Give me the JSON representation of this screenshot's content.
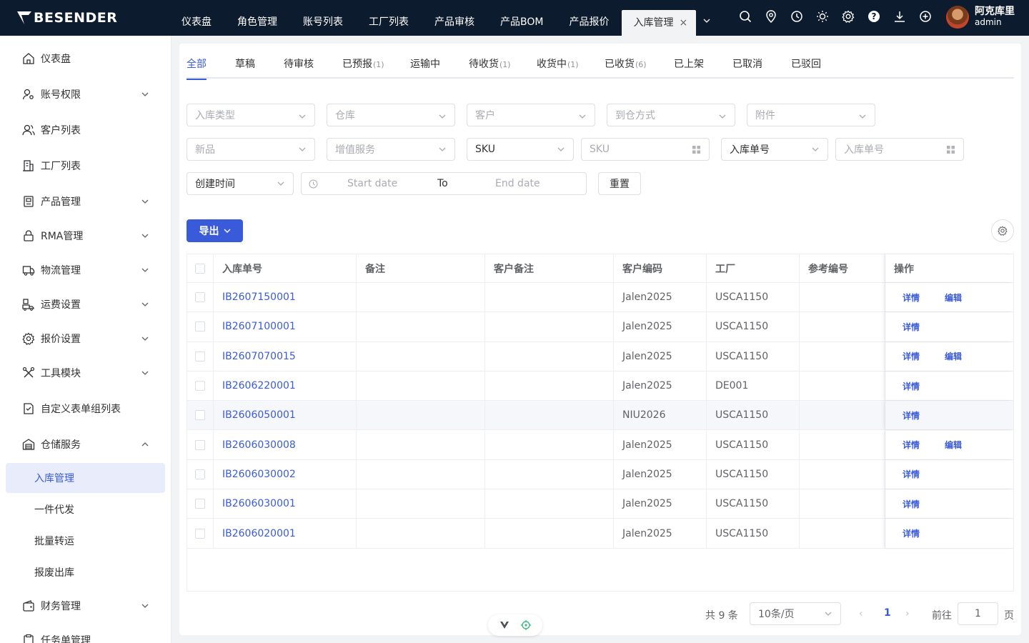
{
  "app": {
    "logo_text": "BESENDER",
    "nav": [
      "仪表盘",
      "角色管理",
      "账号列表",
      "工厂列表",
      "产品审核",
      "产品BOM",
      "产品报价"
    ],
    "active_tab": "入库管理",
    "close_glyph": "×",
    "user": {
      "name": "阿克库里",
      "role": "admin"
    },
    "top_icons": [
      "search-icon",
      "location-icon",
      "clock-icon",
      "sun-icon",
      "gear-icon",
      "help-icon",
      "download-icon",
      "plus-circle-icon"
    ]
  },
  "sidebar": {
    "items": [
      {
        "label": "仪表盘",
        "icon": "home-icon",
        "has_arrow": false
      },
      {
        "label": "账号权限",
        "icon": "user-key-icon",
        "has_arrow": true
      },
      {
        "label": "客户列表",
        "icon": "users-icon",
        "has_arrow": false
      },
      {
        "label": "工厂列表",
        "icon": "building-icon",
        "has_arrow": false
      },
      {
        "label": "产品管理",
        "icon": "box-icon",
        "has_arrow": true
      },
      {
        "label": "RMA管理",
        "icon": "lock-icon",
        "has_arrow": true
      },
      {
        "label": "物流管理",
        "icon": "truck-icon",
        "has_arrow": true
      },
      {
        "label": "运费设置",
        "icon": "shipping-icon",
        "has_arrow": true
      },
      {
        "label": "报价设置",
        "icon": "settings-icon",
        "has_arrow": true
      },
      {
        "label": "工具模块",
        "icon": "tools-icon",
        "has_arrow": true
      },
      {
        "label": "自定义表单组列表",
        "icon": "form-icon",
        "has_arrow": false
      },
      {
        "label": "仓储服务",
        "icon": "warehouse-icon",
        "has_arrow": true,
        "expanded": true
      }
    ],
    "sub_items": [
      "入库管理",
      "一件代发",
      "批量转运",
      "报废出库"
    ],
    "active_sub": "入库管理",
    "after_items": [
      {
        "label": "财务管理",
        "icon": "wallet-icon",
        "has_arrow": true
      },
      {
        "label": "任务单管理",
        "icon": "task-icon",
        "has_arrow": false
      }
    ]
  },
  "tabs": [
    {
      "label": "全部",
      "count": ""
    },
    {
      "label": "草稿",
      "count": ""
    },
    {
      "label": "待审核",
      "count": ""
    },
    {
      "label": "已预报",
      "count": "(1)"
    },
    {
      "label": "运输中",
      "count": ""
    },
    {
      "label": "待收货",
      "count": "(1)"
    },
    {
      "label": "收货中",
      "count": "(1)"
    },
    {
      "label": "已收货",
      "count": "(6)"
    },
    {
      "label": "已上架",
      "count": ""
    },
    {
      "label": "已取消",
      "count": ""
    },
    {
      "label": "已驳回",
      "count": ""
    }
  ],
  "filters": {
    "row1": [
      "入库类型",
      "仓库",
      "客户",
      "到仓方式",
      "附件"
    ],
    "new_product": "新品",
    "value_added": "增值服务",
    "sku_select": "SKU",
    "sku_input": "SKU",
    "order_select": "入库单号",
    "order_input": "入库单号",
    "time_select": "创建时间",
    "start_date": "Start date",
    "to": "To",
    "end_date": "End date",
    "reset": "重置"
  },
  "export_label": "导出",
  "table": {
    "headers": [
      "入库单号",
      "备注",
      "客户备注",
      "客户编码",
      "工厂",
      "参考编号",
      "操作"
    ],
    "rows": [
      {
        "id": "IB2607150001",
        "note": "",
        "cnote": "",
        "code": "Jalen2025",
        "factory": "USCA1150",
        "ref": "",
        "actions": [
          "详情",
          "编辑"
        ]
      },
      {
        "id": "IB2607100001",
        "note": "",
        "cnote": "",
        "code": "Jalen2025",
        "factory": "USCA1150",
        "ref": "",
        "actions": [
          "详情"
        ]
      },
      {
        "id": "IB2607070015",
        "note": "",
        "cnote": "",
        "code": "Jalen2025",
        "factory": "USCA1150",
        "ref": "",
        "actions": [
          "详情",
          "编辑"
        ]
      },
      {
        "id": "IB2606220001",
        "note": "",
        "cnote": "",
        "code": "Jalen2025",
        "factory": "DE001",
        "ref": "",
        "actions": [
          "详情"
        ]
      },
      {
        "id": "IB2606050001",
        "note": "",
        "cnote": "",
        "code": "NIU2026",
        "factory": "USCA1150",
        "ref": "",
        "actions": [
          "详情"
        ],
        "highlight": true
      },
      {
        "id": "IB2606030008",
        "note": "",
        "cnote": "",
        "code": "Jalen2025",
        "factory": "USCA1150",
        "ref": "",
        "actions": [
          "详情",
          "编辑"
        ]
      },
      {
        "id": "IB2606030002",
        "note": "",
        "cnote": "",
        "code": "Jalen2025",
        "factory": "USCA1150",
        "ref": "",
        "actions": [
          "详情"
        ]
      },
      {
        "id": "IB2606030001",
        "note": "",
        "cnote": "",
        "code": "Jalen2025",
        "factory": "USCA1150",
        "ref": "",
        "actions": [
          "详情"
        ]
      },
      {
        "id": "IB2606020001",
        "note": "",
        "cnote": "",
        "code": "Jalen2025",
        "factory": "USCA1150",
        "ref": "",
        "actions": [
          "详情"
        ]
      }
    ]
  },
  "pagination": {
    "total": "共 9 条",
    "page_size": "10条/页",
    "current": "1",
    "goto": "前往",
    "goto_value": "1",
    "page_unit": "页",
    "prev": "‹",
    "next": "›"
  },
  "colors": {
    "primary": "#3a5bd9",
    "topbar": "#0d1b2e",
    "active_bg": "#e9edfb"
  }
}
